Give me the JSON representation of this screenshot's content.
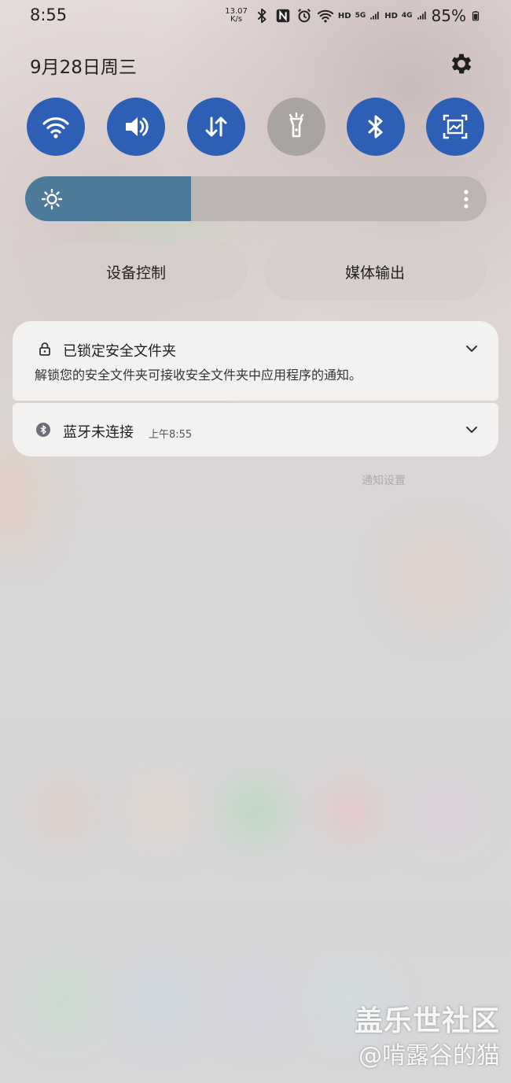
{
  "status_bar": {
    "time": "8:55",
    "net_speed_value": "13.07",
    "net_speed_unit": "K/s",
    "hd1": "HD",
    "net1": "5G",
    "hd2": "HD",
    "net2": "4G",
    "battery": "85%",
    "icons": [
      "bluetooth-icon",
      "nfc-icon",
      "alarm-icon",
      "wifi-icon",
      "signal-icon",
      "battery-icon"
    ]
  },
  "header": {
    "date": "9月28日周三",
    "settings_icon": "gear-icon"
  },
  "quick_settings": {
    "toggles": [
      {
        "icon": "wifi-icon",
        "active": true
      },
      {
        "icon": "sound-icon",
        "active": true
      },
      {
        "icon": "mobile-data-icon",
        "active": true
      },
      {
        "icon": "flashlight-icon",
        "active": false
      },
      {
        "icon": "bluetooth-icon",
        "active": true
      },
      {
        "icon": "screenshot-icon",
        "active": true
      }
    ],
    "active_color": "#2e5fb6",
    "inactive_color": "#a9a4a2"
  },
  "brightness": {
    "level": 0.36,
    "fill_color": "#4b7a9a"
  },
  "controls": {
    "device_control": "设备控制",
    "media_output": "媒体输出"
  },
  "notifications": [
    {
      "icon": "lock-icon",
      "title": "已锁定安全文件夹",
      "body": "解锁您的安全文件夹可接收安全文件夹中应用程序的通知。"
    },
    {
      "icon": "bluetooth-app-icon",
      "title": "蓝牙未连接",
      "time": "上午8:55"
    }
  ],
  "notification_settings": "通知设置",
  "watermark": {
    "line1": "盖乐世社区",
    "line2": "@啃露谷的猫"
  }
}
